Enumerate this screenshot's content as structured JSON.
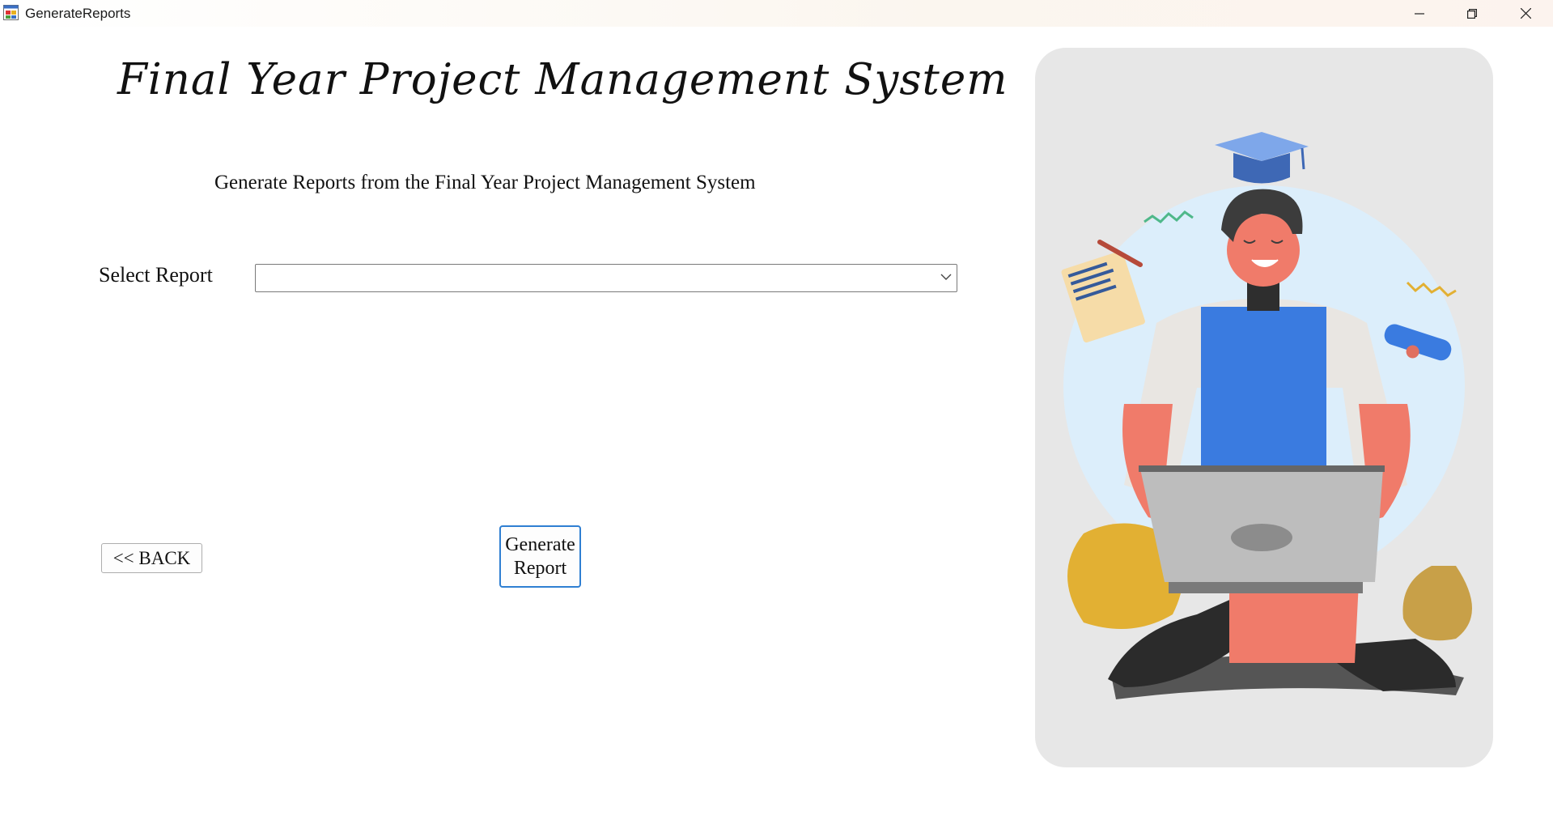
{
  "window": {
    "title": "GenerateReports",
    "icon": "form-app-icon",
    "controls": [
      "minimize-icon",
      "restore-icon",
      "close-icon"
    ]
  },
  "main": {
    "heading": "Final Year Project Management System",
    "subheading": "Generate Reports from the Final Year Project Management System",
    "select_label": "Select Report",
    "select_value": "",
    "back_button": "<< BACK",
    "generate_button_line1": "Generate",
    "generate_button_line2": "Report"
  },
  "colors": {
    "generate_border": "#2f7fd2",
    "card_background": "#e7e7e7"
  }
}
